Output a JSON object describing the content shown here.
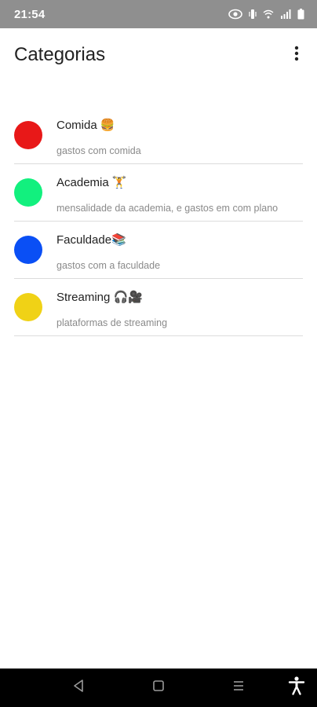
{
  "status_bar": {
    "time": "21:54",
    "icons": [
      "eye-icon",
      "vibrate-icon",
      "wifi-icon",
      "signal-icon",
      "battery-icon"
    ]
  },
  "app_bar": {
    "title": "Categorias",
    "menu_icon": "more-vert-icon"
  },
  "categories": [
    {
      "title": "Comida 🍔",
      "description": "gastos com comida",
      "color": "#e81818"
    },
    {
      "title": "Academia 🏋",
      "description": "mensalidade da academia, e gastos em com plano",
      "color": "#12f07e"
    },
    {
      "title": "Faculdade📚",
      "description": "gastos com a faculdade",
      "color": "#0a4ff5"
    },
    {
      "title": "Streaming 🎧🎥",
      "description": "plataformas de streaming",
      "color": "#f0d216"
    }
  ],
  "nav_bar": {
    "buttons": [
      "back-icon",
      "home-icon",
      "recents-icon",
      "accessibility-icon"
    ]
  }
}
